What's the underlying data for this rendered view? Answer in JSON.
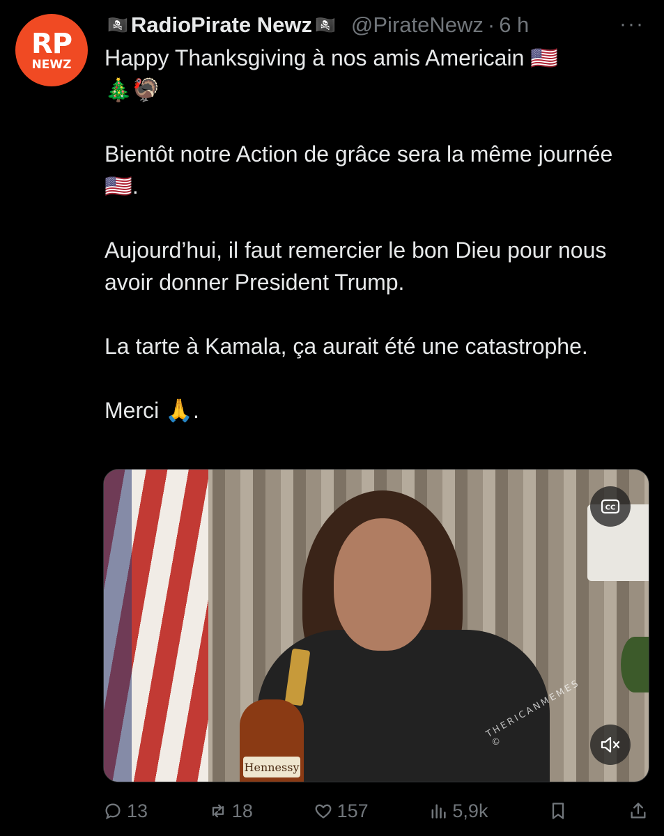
{
  "account": {
    "avatar_line1": "RP",
    "avatar_line2": "NEWZ",
    "flag_left": "🏴‍☠️",
    "name": "RadioPirate Newz",
    "flag_right": "🏴‍☠️",
    "handle": "@PirateNewz",
    "separator": "·",
    "time": "6 h",
    "more": "···"
  },
  "tweet": {
    "text": "Happy Thanksgiving à nos amis Americain 🇺🇸\n🎄🦃\n\nBientôt notre Action de grâce sera la même journée🇺🇸.\n\nAujourd’hui, il faut remercier le bon Dieu pour nous avoir donner President Trump.\n\nLa tarte à Kamala, ça aurait été une catastrophe.\n\nMerci 🙏."
  },
  "media": {
    "bottle_label": "Hennessy",
    "watermark": "THERICANMEMES ©",
    "cc_label": "CC"
  },
  "actions": {
    "replies": "13",
    "reposts": "18",
    "likes": "157",
    "views": "5,9k"
  },
  "icons": {
    "reply": "reply-icon",
    "repost": "repost-icon",
    "like": "heart-icon",
    "views": "views-icon",
    "bookmark": "bookmark-icon",
    "share": "share-icon",
    "cc": "closed-caption-icon",
    "mute": "mute-icon"
  },
  "colors": {
    "background": "#000000",
    "text": "#e7e9ea",
    "muted": "#71767b",
    "avatar": "#f04a23"
  }
}
